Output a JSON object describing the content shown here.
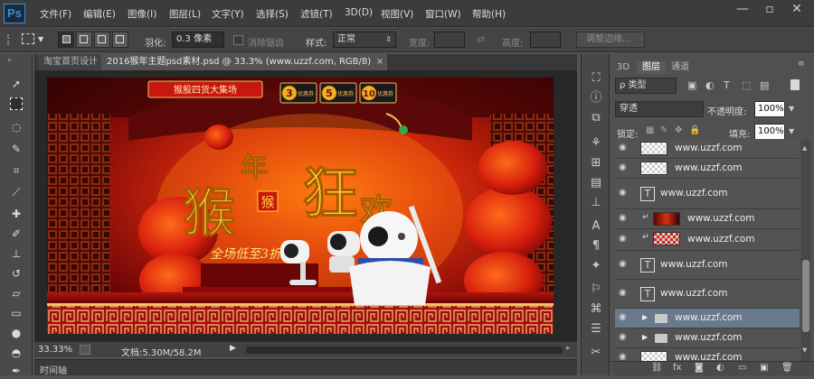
{
  "app": {
    "logo": "Ps"
  },
  "menu": [
    "文件(F)",
    "编辑(E)",
    "图像(I)",
    "图层(L)",
    "文字(Y)",
    "选择(S)",
    "滤镜(T)",
    "3D(D)",
    "视图(V)",
    "窗口(W)",
    "帮助(H)"
  ],
  "window_controls": {
    "minimize": "—",
    "restore": "▫",
    "close": "✕"
  },
  "options": {
    "feather_label": "羽化:",
    "feather_value": "0.3 像素",
    "antialias_label": "消除锯齿",
    "style_label": "样式:",
    "style_value": "正常",
    "width_label": "宽度:",
    "height_label": "高度:",
    "refine_label": "调整边缘..."
  },
  "doc_tabs": [
    "淘宝首页设计",
    "2016猴年主题psd素材.psd @ 33.3% (www.uzzf.com, RGB/8)"
  ],
  "doc_tab_close": "×",
  "status": {
    "zoom": "33.33%",
    "doc_info": "文档:5.30M/58.2M"
  },
  "timeline_label": "时间轴",
  "panel": {
    "tabs": [
      "3D",
      "图层",
      "通道"
    ],
    "filter_label": "ρ 类型",
    "blend_mode": "穿透",
    "opacity_label": "不透明度:",
    "opacity_value": "100%",
    "lock_label": "锁定:",
    "fill_label": "填充:",
    "fill_value": "100%",
    "layers": [
      {
        "name": "www.uzzf.com",
        "thumb": "checker",
        "selected": false
      },
      {
        "name": "www.uzzf.com",
        "thumb": "checker",
        "selected": false
      },
      {
        "name": "www.uzzf.com",
        "thumb": "text",
        "selected": false
      },
      {
        "name": "www.uzzf.com",
        "thumb": "red-image",
        "selected": false
      },
      {
        "name": "www.uzzf.com",
        "thumb": "red-checker",
        "selected": false
      },
      {
        "name": "www.uzzf.com",
        "thumb": "text",
        "selected": false
      },
      {
        "name": "www.uzzf.com",
        "thumb": "text",
        "selected": false
      },
      {
        "name": "www.uzzf.com",
        "thumb": "folder",
        "selected": true
      },
      {
        "name": "www.uzzf.com",
        "thumb": "folder",
        "selected": false
      },
      {
        "name": "www.uzzf.com",
        "thumb": "checker",
        "selected": false
      }
    ],
    "footer_icons": [
      "link-icon",
      "fx-icon",
      "mask-icon",
      "adjustment-icon",
      "group-icon",
      "new-layer-icon",
      "trash-icon"
    ],
    "footer_glyphs": [
      "⛓",
      "fx",
      "◙",
      "◐",
      "▭",
      "▣",
      "🗑"
    ]
  },
  "banner": {
    "promo_top": "猴股四货大集场",
    "badges": [
      "3",
      "5",
      "10"
    ],
    "badge_captions": [
      "优惠券",
      "优惠券",
      "优惠券"
    ],
    "headline_chars": [
      "猴",
      "年",
      "狂",
      "欢"
    ],
    "seal": "猴",
    "subline": "全场低至3折"
  }
}
